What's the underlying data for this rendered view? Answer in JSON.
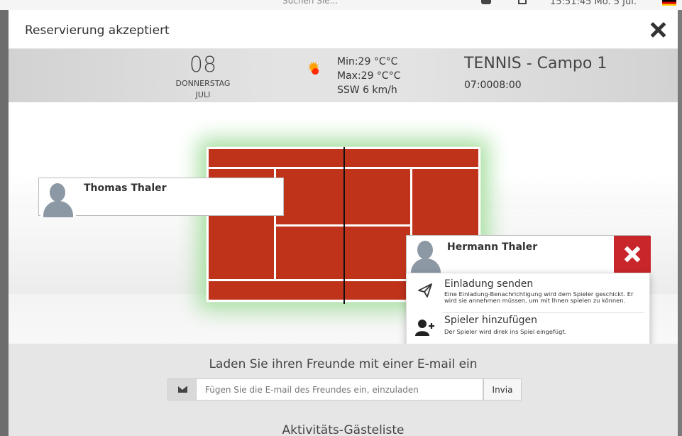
{
  "background": {
    "search_text": "Suchen Sie...",
    "clock_text": "15:51:45  Mo. 5 Jul."
  },
  "modal": {
    "title": "Reservierung akzeptiert"
  },
  "date": {
    "day": "08",
    "weekday": "DONNERSTAG",
    "month": "JULI"
  },
  "weather": {
    "icon": "sun-icon",
    "min": "Min:29 °C°C",
    "max": "Max:29 °C°C",
    "wind": "SSW 6 km/h"
  },
  "court": {
    "name": "TENNIS - Campo 1",
    "time": "07:0008:00",
    "color": "#c0331b",
    "glow_color": "#a6dfa0"
  },
  "players": {
    "left": {
      "name": "Thomas Thaler"
    },
    "right": {
      "name": "Hermann Thaler"
    }
  },
  "menu": {
    "invite": {
      "icon": "paper-plane-icon",
      "title": "Einladung senden",
      "desc": "Eine Einladung-Benachrichtigung wird dem Spieler geschickt. Er wird sie annehmen müssen, um mit Ihnen spielen zu können."
    },
    "add": {
      "icon": "add-user-icon",
      "title": "Spieler hinzufügen",
      "desc": "Der Spieler wird direk ins Spiel eingefügt."
    }
  },
  "invite_section": {
    "title": "Laden Sie ihren Freunde mit einer E-mail ein",
    "placeholder": "Fügen Sie die E-mail des Freundes ein, einzuladen",
    "button": "Invia"
  },
  "guest_list": {
    "title": "Aktivitäts-Gästeliste"
  },
  "colors": {
    "danger": "#c9262c"
  }
}
